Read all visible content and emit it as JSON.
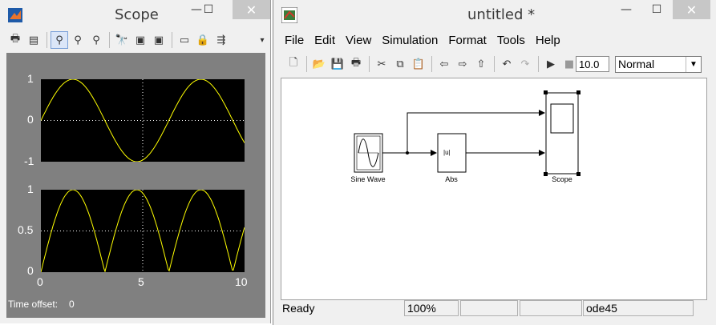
{
  "scope_window": {
    "title": "Scope",
    "toolbar_icons": [
      "print-icon",
      "params-icon",
      "zoom-icon",
      "zoom-x-icon",
      "zoom-y-icon",
      "autoscale-icon",
      "save-axes-icon",
      "restore-axes-icon",
      "floating-scope-icon",
      "lock-icon",
      "signal-selector-icon",
      "toolbar-menu-icon"
    ],
    "plot_top": {
      "yticks": [
        "1",
        "0",
        "-1"
      ]
    },
    "plot_bottom": {
      "yticks": [
        "1",
        "0.5",
        "0"
      ],
      "xticks": [
        "0",
        "5",
        "10"
      ]
    },
    "time_offset_label": "Time offset:",
    "time_offset_value": "0",
    "trace_color": "#ffff00"
  },
  "chart_data": [
    {
      "type": "line",
      "series": [
        {
          "values": "sin(t)"
        }
      ],
      "x_range": [
        0,
        10
      ],
      "ylim": [
        -1,
        1
      ],
      "yticks": [
        -1,
        0,
        1
      ],
      "grid": true
    },
    {
      "type": "line",
      "series": [
        {
          "values": "|sin(t)|"
        }
      ],
      "x_range": [
        0,
        10
      ],
      "ylim": [
        0,
        1
      ],
      "xticks": [
        0,
        5,
        10
      ],
      "yticks": [
        0,
        0.5,
        1
      ],
      "grid": true
    }
  ],
  "simulink_window": {
    "title": "untitled *",
    "menu": [
      "File",
      "Edit",
      "View",
      "Simulation",
      "Format",
      "Tools",
      "Help"
    ],
    "stop_time": "10.0",
    "sim_mode": "Normal",
    "blocks": {
      "sine": "Sine Wave",
      "abs": "Abs",
      "abs_symbol": "|u|",
      "scope": "Scope"
    },
    "status": {
      "state": "Ready",
      "zoom": "100%",
      "solver": "ode45"
    }
  }
}
